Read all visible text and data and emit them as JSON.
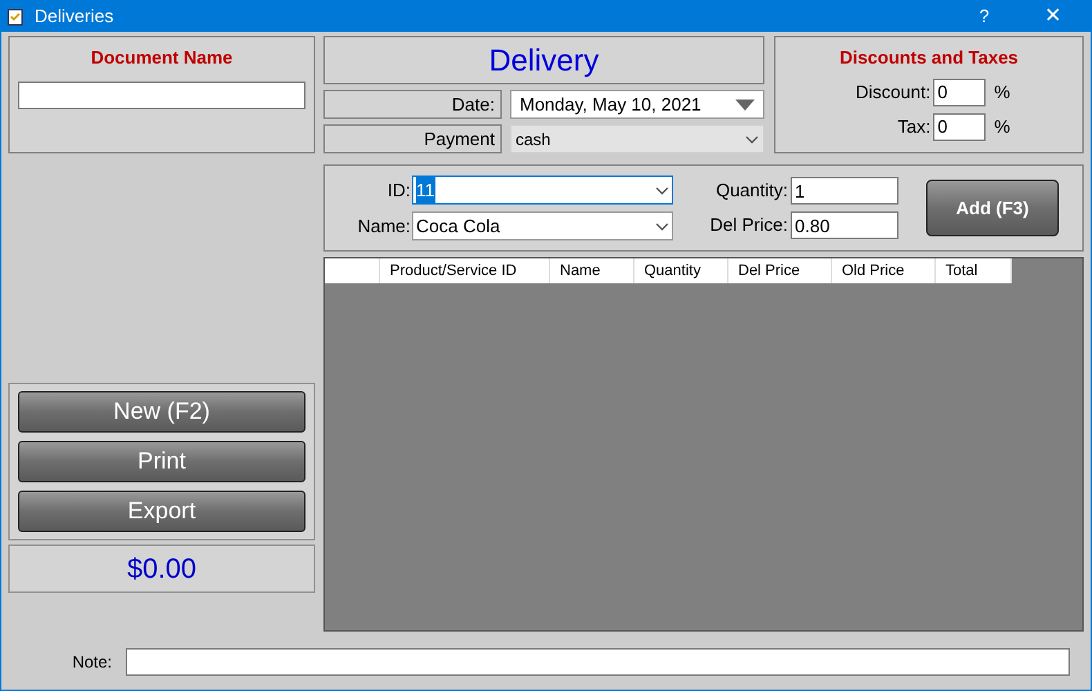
{
  "window": {
    "title": "Deliveries",
    "help": "?",
    "close": "✕"
  },
  "document_name": {
    "label": "Document Name"
  },
  "header": {
    "title": "Delivery"
  },
  "date": {
    "label": "Date:",
    "value": "Monday, May 10, 2021"
  },
  "payment": {
    "label": "Payment",
    "value": "cash",
    "disabled": true
  },
  "discounts": {
    "title": "Discounts and Taxes",
    "fields": [
      {
        "label": "Discount:",
        "value": "0",
        "unit": "%"
      },
      {
        "label": "Tax:",
        "value": "0",
        "unit": "%"
      }
    ]
  },
  "entry": {
    "id": {
      "label": "ID:",
      "value": "11",
      "highlighted": true
    },
    "name": {
      "label": "Name:",
      "value": "Coca Cola"
    },
    "quantity": {
      "label": "Quantity:",
      "value": "1"
    },
    "del_price": {
      "label": "Del Price:",
      "value": "0.80"
    },
    "add_button": "Add (F3)"
  },
  "table": {
    "columns": [
      "Product/Service ID",
      "Name",
      "Quantity",
      "Del Price",
      "Old Price",
      "Total"
    ]
  },
  "buttons": [
    "New (F2)",
    "Print",
    "Export"
  ],
  "total": "$0.00",
  "note": {
    "label": "Note:"
  }
}
